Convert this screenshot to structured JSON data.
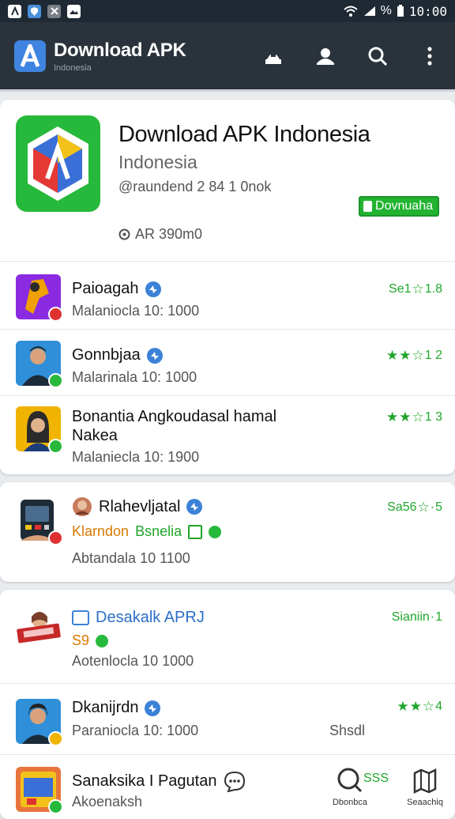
{
  "status": {
    "time": "10:00",
    "battery": "%"
  },
  "appbar": {
    "title": "Download APK",
    "subtitle": "Indonesia"
  },
  "hero": {
    "title": "Download APK Indonesia",
    "subtitle": "Indonesia",
    "meta": "@raundend 2 84 1 0nok",
    "download_label": "Dovnuaha",
    "size": "AR 390m0"
  },
  "list1": [
    {
      "name": "Paioagah",
      "sub": "Malaniocla 10: 1000",
      "rating": "Se1",
      "stars_filled": 0,
      "rating_num": "1.8",
      "avatar_color": "#8a2be2",
      "badge_color": "#e03131"
    },
    {
      "name": "Gonnbjaa",
      "sub": "Malarinala 10: 1000",
      "rating": "",
      "stars_filled": 2,
      "rating_num": "1 2",
      "avatar_color": "#2f8fd8",
      "badge_color": "#27b93b"
    },
    {
      "name": "Bonantia Angkoudasal hamal",
      "name2": "Nakea",
      "sub": "Malaniecla 10: 1900",
      "rating": "",
      "stars_filled": 2,
      "rating_num": "1 3",
      "avatar_color": "#f0b400",
      "badge_color": "#27b93b"
    }
  ],
  "card2": {
    "name": "Rlahevljatal",
    "rating": "Sa56",
    "rating_num": "5",
    "tag1": "Klarndon",
    "tag2": "Bsnelia",
    "sub": "Abtandala 10 1100"
  },
  "card3": {
    "name": "Desakalk APRJ",
    "rating": "Sianiin",
    "rating_num": "1",
    "tag": "S9",
    "sub": "Aotenlocla 10 1000",
    "row_name": "Dkanijrdn",
    "row_sub": "Paraniocla 10: 1000",
    "row_rating_num": "4",
    "row_right": "Shsdl",
    "row2_name": "Sanaksika I Pagutan",
    "row2_sub": "Akoenaksh",
    "row2_rating": "SSS",
    "nav_download": "Dbonbca",
    "nav_search": "Seaachiq"
  }
}
